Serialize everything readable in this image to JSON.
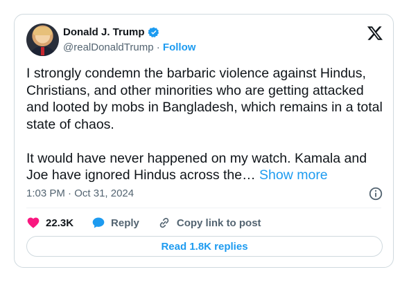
{
  "author": {
    "name": "Donald J. Trump",
    "handle": "@realDonaldTrump",
    "separator": "·",
    "follow_label": "Follow"
  },
  "tweet": {
    "text": "I strongly condemn the barbaric violence against Hindus, Christians, and other minorities who are getting attacked and looted by mobs in Bangladesh, which remains in a total state of chaos.\n\nIt would have never happened on my watch. Kamala and Joe have ignored Hindus across the… ",
    "show_more": "Show more",
    "time": "1:03 PM",
    "date_separator": "·",
    "date": "Oct 31, 2024"
  },
  "actions": {
    "likes": "22.3K",
    "reply_label": "Reply",
    "copy_label": "Copy link to post"
  },
  "replies_button": "Read 1.8K replies",
  "icons": {
    "logo": "x-logo-icon",
    "verified": "verified-badge-icon",
    "info": "info-icon",
    "like": "heart-icon",
    "reply": "reply-bubble-icon",
    "copy": "link-icon"
  },
  "colors": {
    "accent": "#1d9bf0",
    "like": "#f91880",
    "secondary_text": "#536471"
  }
}
